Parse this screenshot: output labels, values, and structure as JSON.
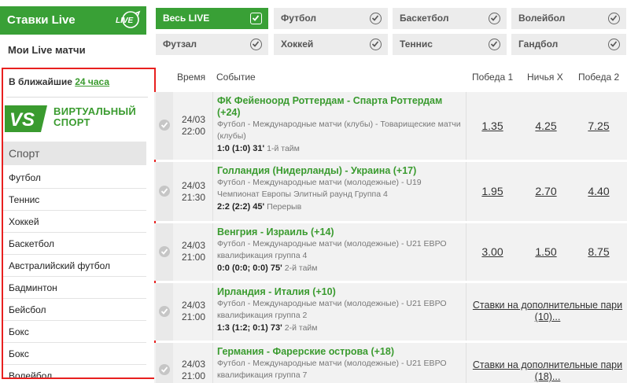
{
  "header": {
    "title": "Ставки Live",
    "logo_text": "LIVE"
  },
  "my_live": "Мои Live матчи",
  "nearest": {
    "prefix": "В ближайшие ",
    "link": "24 часа"
  },
  "virtual": {
    "badge": "VS",
    "line1": "ВИРТУАЛЬНЫЙ",
    "line2": "СПОРТ"
  },
  "sport_heading": "Спорт",
  "sports": [
    "Футбол",
    "Теннис",
    "Хоккей",
    "Баскетбол",
    "Австралийский футбол",
    "Бадминтон",
    "Бейсбол",
    "Бокс",
    "Бокс",
    "Волейбол"
  ],
  "filters": [
    {
      "label": "Весь LIVE",
      "active": true
    },
    {
      "label": "Футбол",
      "active": false
    },
    {
      "label": "Баскетбол",
      "active": false
    },
    {
      "label": "Волейбол",
      "active": false
    },
    {
      "label": "Футзал",
      "active": false
    },
    {
      "label": "Хоккей",
      "active": false
    },
    {
      "label": "Теннис",
      "active": false
    },
    {
      "label": "Гандбол",
      "active": false
    }
  ],
  "columns": {
    "time": "Время",
    "event": "Событие",
    "win1": "Победа 1",
    "draw": "Ничья X",
    "win2": "Победа 2"
  },
  "matches": [
    {
      "date": "24/03",
      "time": "22:00",
      "title": "ФК Фейеноорд Роттердам - Спарта Роттердам (+24)",
      "sub": "Футбол - Международные матчи (клубы) - Товарищеские матчи (клубы)",
      "score": "1:0 (1:0) 31'",
      "period": "1-й тайм",
      "odds": [
        "1.35",
        "4.25",
        "7.25"
      ]
    },
    {
      "date": "24/03",
      "time": "21:30",
      "title": "Голландия (Нидерланды) - Украина (+17)",
      "sub": "Футбол - Международные матчи (молодежные) - U19 Чемпионат Европы Элитный раунд Группа 4",
      "score": "2:2 (2:2) 45'",
      "period": "Перерыв",
      "odds": [
        "1.95",
        "2.70",
        "4.40"
      ]
    },
    {
      "date": "24/03",
      "time": "21:00",
      "title": "Венгрия - Израиль (+14)",
      "sub": "Футбол - Международные матчи (молодежные) - U21 ЕВРО квалификация группа 4",
      "score": "0:0 (0:0; 0:0) 75'",
      "period": "2-й тайм",
      "odds": [
        "3.00",
        "1.50",
        "8.75"
      ]
    },
    {
      "date": "24/03",
      "time": "21:00",
      "title": "Ирландия - Италия (+10)",
      "sub": "Футбол - Международные матчи (молодежные) - U21 ЕВРО квалификация группа 2",
      "score": "1:3 (1:2; 0:1) 73'",
      "period": "2-й тайм",
      "more": "Ставки на дополнительные пари (10)..."
    },
    {
      "date": "24/03",
      "time": "21:00",
      "title": "Германия - Фарерские острова (+18)",
      "sub": "Футбол - Международные матчи (молодежные) - U21 ЕВРО квалификация группа 7",
      "score": "",
      "period": "",
      "more": "Ставки на дополнительные пари (18)..."
    }
  ],
  "colors": {
    "brand_green": "#39a036",
    "link_green": "#3a9b2f",
    "highlight_red": "#e8201f"
  }
}
